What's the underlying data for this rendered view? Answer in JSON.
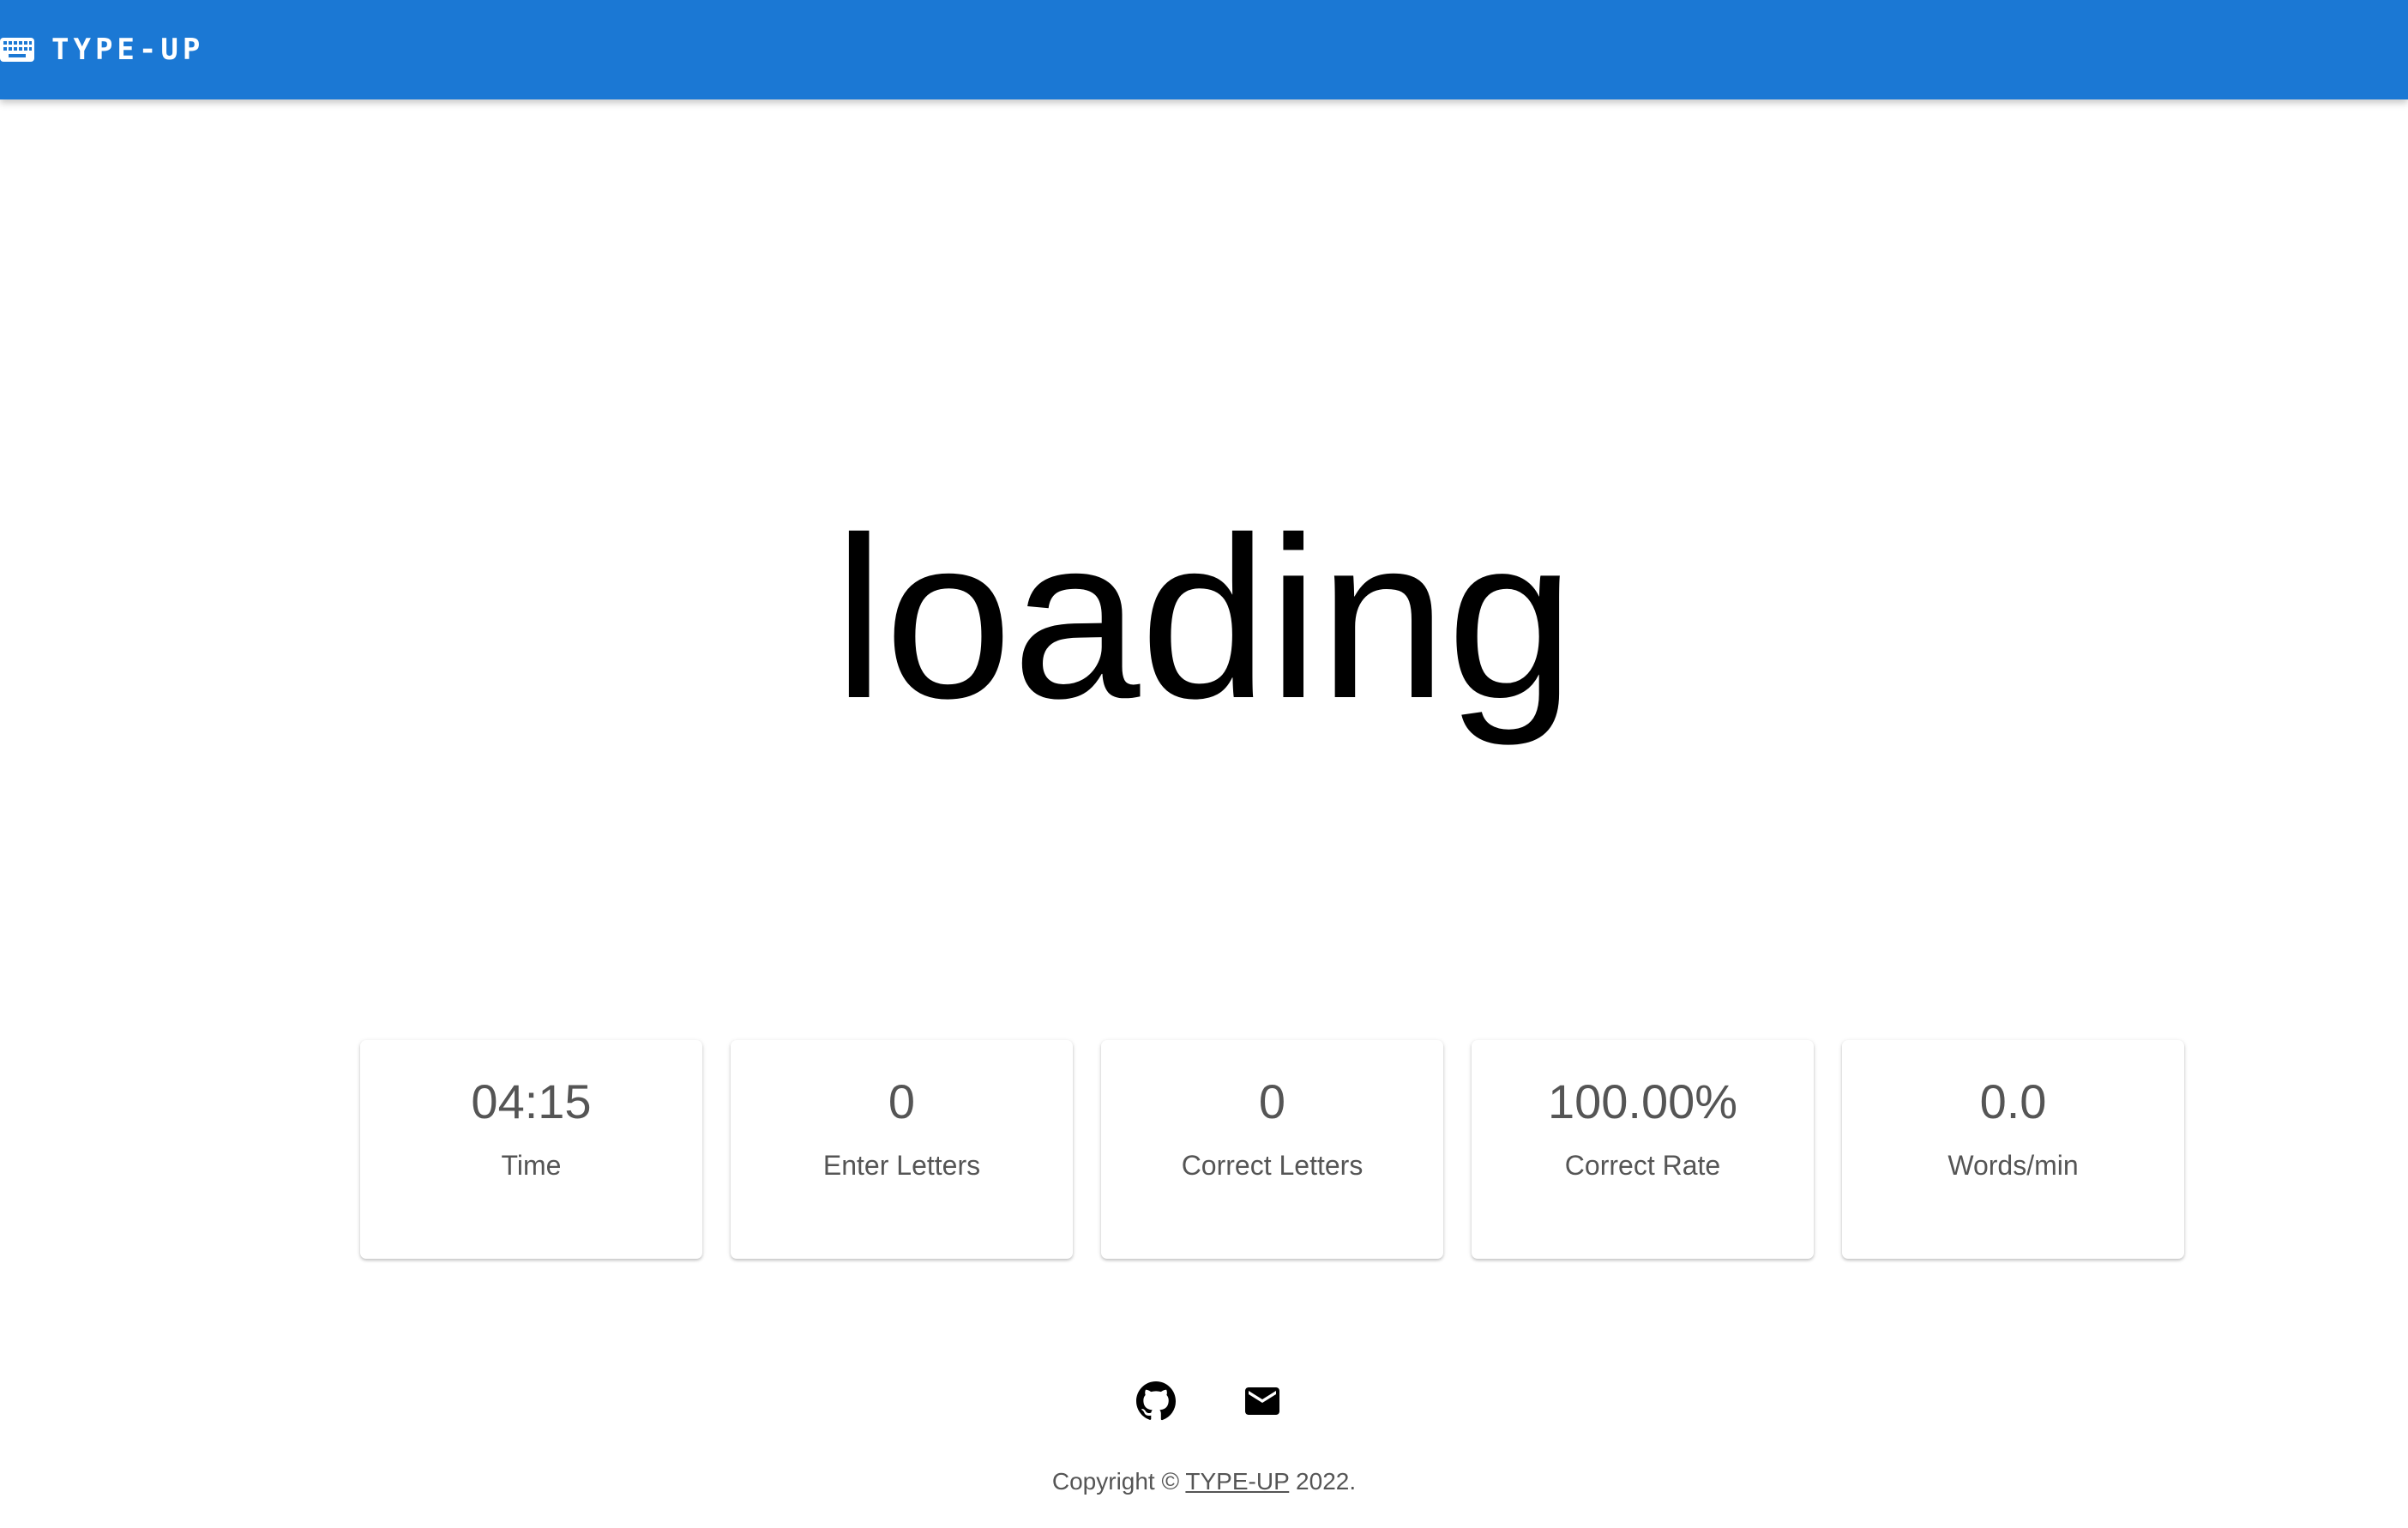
{
  "appbar": {
    "title": "TYPE-UP",
    "icon": "keyboard-icon",
    "bg_color": "#1b78d4"
  },
  "main": {
    "current_word": "loading"
  },
  "stats": [
    {
      "value": "04:15",
      "label": "Time"
    },
    {
      "value": "0",
      "label": "Enter Letters"
    },
    {
      "value": "0",
      "label": "Correct Letters"
    },
    {
      "value": "100.00%",
      "label": "Correct Rate"
    },
    {
      "value": "0.0",
      "label": "Words/min"
    }
  ],
  "footer": {
    "icons": [
      "github-icon",
      "mail-icon"
    ],
    "copyright_prefix": "Copyright © ",
    "copyright_link": "TYPE-UP",
    "copyright_suffix": " 2022."
  }
}
